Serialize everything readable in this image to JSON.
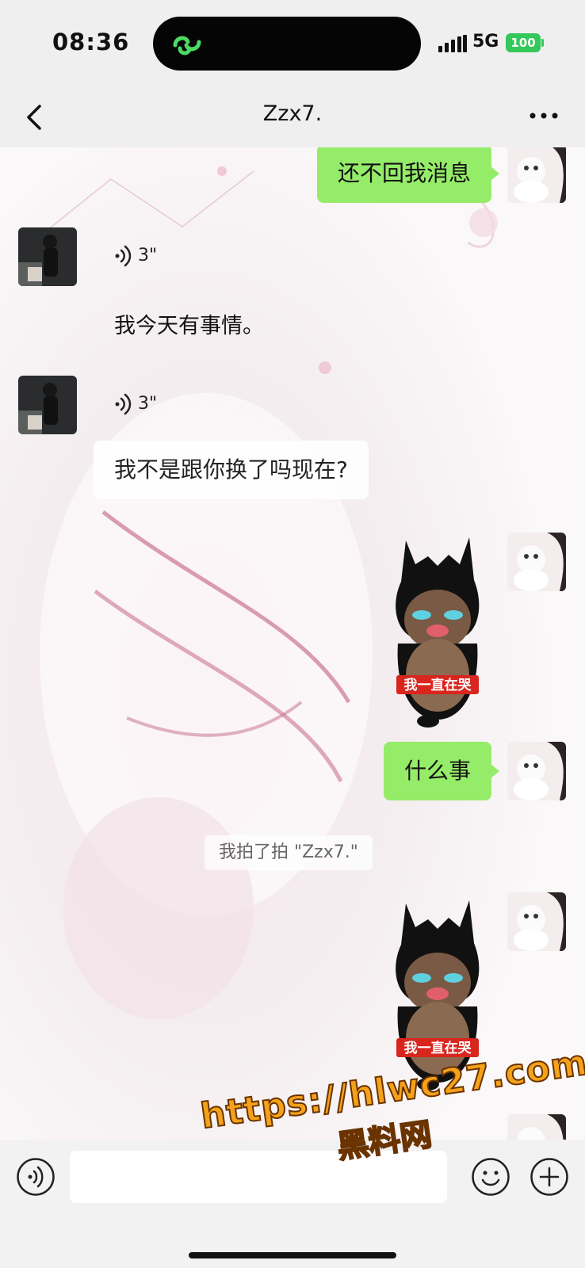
{
  "status_bar": {
    "time": "08:36",
    "network": "5G",
    "battery": "100",
    "island_icon": "link-app-icon",
    "signal_icon": "signal-icon"
  },
  "nav": {
    "back_icon": "chevron-left-icon",
    "title": "Zzx7.",
    "more_icon": "more-dots-icon"
  },
  "messages": [
    {
      "side": "right",
      "type": "text",
      "text": "还不回我消息"
    },
    {
      "side": "left",
      "type": "voice",
      "duration": "3\""
    },
    {
      "side": "left",
      "type": "text",
      "text": "我今天有事情。"
    },
    {
      "side": "left",
      "type": "voice",
      "duration": "3\""
    },
    {
      "side": "left",
      "type": "text",
      "text": "我不是跟你换了吗现在?"
    },
    {
      "side": "right",
      "type": "sticker",
      "caption": "我一直在哭"
    },
    {
      "side": "right",
      "type": "text",
      "text": "什么事"
    },
    {
      "side": "right",
      "type": "sticker",
      "caption": "我一直在哭"
    }
  ],
  "system_notice": "我拍了拍 \"Zzx7.\"",
  "input_bar": {
    "voice_icon": "voice-icon",
    "emoji_icon": "smile-icon",
    "plus_icon": "plus-icon"
  },
  "watermark": {
    "line1": "https://hlwc27.com",
    "line2": "黑料网"
  },
  "colors": {
    "self_bubble": "#95ec69",
    "other_bubble": "#ffffff",
    "watermark": "#f5a21b",
    "battery": "#34c759"
  }
}
